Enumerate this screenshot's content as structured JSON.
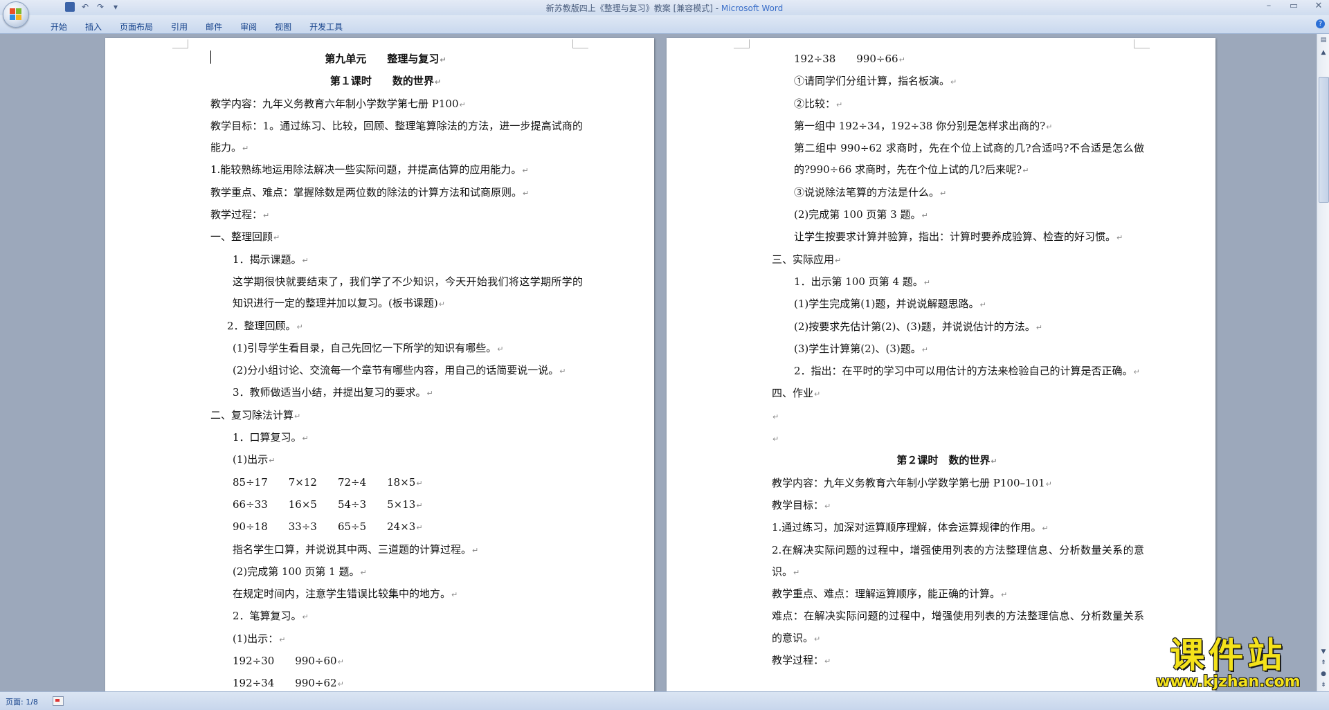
{
  "window": {
    "title_main": "新苏教版四上《整理与复习》教案 [兼容模式] - ",
    "title_app": "Microsoft Word",
    "controls": [
      "–",
      "▭",
      "✕"
    ]
  },
  "quick_access": {
    "save_icon": "save-icon",
    "undo_icon": "undo-icon",
    "redo_icon": "redo-icon",
    "customize_glyph": "▾"
  },
  "ribbon": {
    "tabs": [
      "开始",
      "插入",
      "页面布局",
      "引用",
      "邮件",
      "审阅",
      "视图",
      "开发工具"
    ],
    "help_glyph": "?"
  },
  "document": {
    "left_page": [
      {
        "t": "第九单元　　整理与复习",
        "cls": "h"
      },
      {
        "t": "第１课时　　数的世界",
        "cls": "h"
      },
      {
        "t": "教学内容：九年义务教育六年制小学数学第七册 P100",
        "cls": "i1"
      },
      {
        "t": "教学目标：1。通过练习、比较，回顾、整理笔算除法的方法，进一步提高试商的能力。",
        "cls": "i1 just"
      },
      {
        "t": "1.能较熟练地运用除法解决一些实际问题，并提高估算的应用能力。",
        "cls": "i1"
      },
      {
        "t": "教学重点、难点：掌握除数是两位数的除法的计算方法和试商原则。",
        "cls": "i1"
      },
      {
        "t": "教学过程：",
        "cls": "i1"
      },
      {
        "t": "一、整理回顾",
        "cls": "i1"
      },
      {
        "t": "1．揭示课题。",
        "cls": "i2"
      },
      {
        "t": "这学期很快就要结束了，我们学了不少知识，今天开始我们将这学期所学的知识进行一定的整理并加以复习。(板书课题)",
        "cls": "i2 just"
      },
      {
        "t": "2．整理回顾。",
        "cls": "i3"
      },
      {
        "t": "(1)引导学生看目录，自己先回忆一下所学的知识有哪些。",
        "cls": "i2"
      },
      {
        "t": "(2)分小组讨论、交流每一个章节有哪些内容，用自己的话简要说一说。",
        "cls": "i2"
      },
      {
        "t": "3．教师做适当小结，并提出复习的要求。",
        "cls": "i2"
      },
      {
        "t": "二、复习除法计算",
        "cls": "i1"
      },
      {
        "t": "1．口算复习。",
        "cls": "i2"
      },
      {
        "t": "(1)出示",
        "cls": "i2"
      },
      {
        "t": "85÷17　　7×12　　72÷4　　18×5",
        "cls": "i2"
      },
      {
        "t": "66÷33　　16×5　　54÷3　　5×13",
        "cls": "i2"
      },
      {
        "t": "90÷18　　33÷3　　65÷5　　24×3",
        "cls": "i2"
      },
      {
        "t": "指名学生口算，并说说其中两、三道题的计算过程。",
        "cls": "i2"
      },
      {
        "t": "(2)完成第 100 页第 1 题。",
        "cls": "i2"
      },
      {
        "t": "在规定时间内，注意学生错误比较集中的地方。",
        "cls": "i2"
      },
      {
        "t": "2．笔算复习。",
        "cls": "i2"
      },
      {
        "t": "(1)出示：",
        "cls": "i2"
      },
      {
        "t": "192÷30　　990÷60",
        "cls": "i2"
      },
      {
        "t": "192÷34　　990÷62",
        "cls": "i2"
      }
    ],
    "right_page": [
      {
        "t": "192÷38　　990÷66",
        "cls": "i2"
      },
      {
        "t": "①请同学们分组计算，指名板演。",
        "cls": "i2"
      },
      {
        "t": "②比较：",
        "cls": "i2"
      },
      {
        "t": "第一组中 192÷34，192÷38 你分别是怎样求出商的?",
        "cls": "i2"
      },
      {
        "t": "第二组中 990÷62 求商时，先在个位上试商的几?合适吗?不合适是怎么做的?990÷66 求商时，先在个位上试的几?后来呢?",
        "cls": "i2 just"
      },
      {
        "t": "③说说除法笔算的方法是什么。",
        "cls": "i2"
      },
      {
        "t": "(2)完成第 100 页第 3 题。",
        "cls": "i2"
      },
      {
        "t": "让学生按要求计算并验算，指出：计算时要养成验算、检查的好习惯。",
        "cls": "i2"
      },
      {
        "t": "三、实际应用",
        "cls": "i1"
      },
      {
        "t": "1．出示第 100 页第 4 题。",
        "cls": "i2"
      },
      {
        "t": "(1)学生完成第(1)题，并说说解题思路。",
        "cls": "i2"
      },
      {
        "t": "(2)按要求先估计第(2)、(3)题，并说说估计的方法。",
        "cls": "i2"
      },
      {
        "t": "(3)学生计算第(2)、(3)题。",
        "cls": "i2"
      },
      {
        "t": "2．指出：在平时的学习中可以用估计的方法来检验自己的计算是否正确。",
        "cls": "i2 just"
      },
      {
        "t": "四、作业",
        "cls": "i1"
      },
      {
        "t": "",
        "cls": "i1"
      },
      {
        "t": "",
        "cls": "i1"
      },
      {
        "t": "第２课时　数的世界",
        "cls": "h"
      },
      {
        "t": "教学内容：九年义务教育六年制小学数学第七册 P100–101",
        "cls": "i1"
      },
      {
        "t": "教学目标：",
        "cls": "i1"
      },
      {
        "t": "1.通过练习，加深对运算顺序理解，体会运算规律的作用。",
        "cls": "i1"
      },
      {
        "t": "2.在解决实际问题的过程中，增强使用列表的方法整理信息、分析数量关系的意识。",
        "cls": "i1 just"
      },
      {
        "t": "教学重点、难点：理解运算顺序，能正确的计算。",
        "cls": "i1"
      },
      {
        "t": "难点：在解决实际问题的过程中，增强使用列表的方法整理信息、分析数量关系的意识。",
        "cls": "i1 just"
      },
      {
        "t": "教学过程：",
        "cls": "i1"
      }
    ],
    "para_mark": "↵"
  },
  "statusbar": {
    "page_info": "页面: 1/8"
  },
  "watermark": {
    "title": "课件站",
    "url": "www.kjzhan.com"
  },
  "colors": {
    "ribbon_text": "#15428b",
    "workspace": "#9ca8bb",
    "watermark_yellow": "#f4e21a"
  }
}
